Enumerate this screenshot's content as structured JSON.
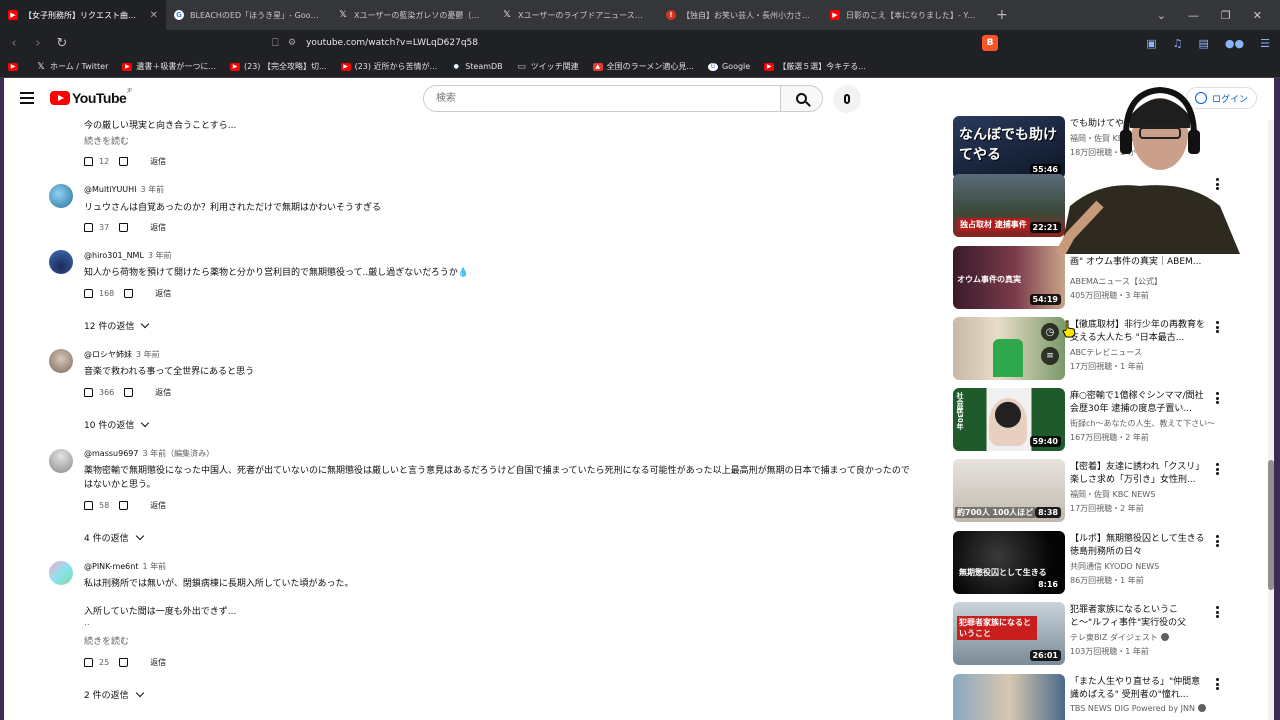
{
  "browser": {
    "tabs": [
      {
        "label": "【女子刑務所】リクエスト曲は「回家」",
        "icon": "youtube-icon",
        "active": true
      },
      {
        "label": "BLEACHのED「ほうき星」- Google 検索",
        "icon": "google-icon",
        "active": false
      },
      {
        "label": "Xユーザーの藍染ガレソの憂鬱（裏垢）",
        "icon": "x-icon",
        "active": false
      },
      {
        "label": "Xユーザーのライブドアニュースさん：「【容疑】",
        "icon": "x-icon",
        "active": false
      },
      {
        "label": "【独自】お笑い芸人・長州小力さんを逮捕",
        "icon": "news-icon",
        "active": false
      },
      {
        "label": "日影のこえ【本になりました】- YouTube",
        "icon": "youtube-icon",
        "active": false
      }
    ],
    "url": "youtube.com/watch?v=LWLqD627q58",
    "bookmarks": [
      {
        "label": "ホーム / Twitter",
        "icon": "x-icon"
      },
      {
        "label": "遺書＋吸書が一つに...",
        "icon": "youtube-icon"
      },
      {
        "label": "(23) 【完全攻略】切...",
        "icon": "youtube-icon"
      },
      {
        "label": "(23) 近所から苦情が...",
        "icon": "youtube-icon"
      },
      {
        "label": "SteamDB",
        "icon": "steam-icon"
      },
      {
        "label": "ツイッチ関連",
        "icon": "folder-icon"
      },
      {
        "label": "全国のラーメン適心見...",
        "icon": "ramen-icon"
      },
      {
        "label": "Google",
        "icon": "google-icon"
      },
      {
        "label": "【厳選５選】今キテる...",
        "icon": "youtube-icon"
      }
    ]
  },
  "header": {
    "logo_word": "YouTube",
    "logo_region": "JP",
    "search_placeholder": "検索",
    "login_label": "ログイン"
  },
  "comments": [
    {
      "id": "c0",
      "body_lines": [
        "今の厳しい現実と向き合うことすら..."
      ],
      "read_more": "続きを読む",
      "likes": "12",
      "reply_label": "返信"
    },
    {
      "id": "c1",
      "author": "@MultiYUUHI",
      "date": "3 年前",
      "body_lines": [
        "リュウさんは自覚あったのか？利用されただけで無期はかわいそうすぎる"
      ],
      "likes": "37",
      "reply_label": "返信"
    },
    {
      "id": "c2",
      "author": "@hiro301_NML",
      "date": "3 年前",
      "body_lines": [
        "知人から荷物を預けて開けたら薬物と分かり営利目的で無期懲役って..厳し過ぎないだろうか💧"
      ],
      "likes": "168",
      "reply_label": "返信",
      "replies_label": "12 件の返信"
    },
    {
      "id": "c3",
      "author": "@ロシヤ姉妹",
      "date": "3 年前",
      "body_lines": [
        "音楽で救われる事って全世界にあると思う"
      ],
      "likes": "366",
      "reply_label": "返信",
      "replies_label": "10 件の返信"
    },
    {
      "id": "c4",
      "author": "@massu9697",
      "date": "3 年前（編集済み）",
      "body_lines": [
        "薬物密輸で無期懲役になった中国人、死者が出ていないのに無期懲役は厳しいと言う意見はあるだろうけど自国で捕まっていたら死刑になる可能性があった以上最高刑が無期の日本で捕まって良かったので",
        "はないかと思う。"
      ],
      "likes": "58",
      "reply_label": "返信",
      "replies_label": "4 件の返信"
    },
    {
      "id": "c5",
      "author": "@PINK-me6nt",
      "date": "1 年前",
      "body_lines": [
        "私は刑務所では無いが、閉鎖病棟に長期入所していた頃があった。",
        "",
        "入所していた間は一度も外出できず...",
        ".."
      ],
      "read_more": "続きを読む",
      "likes": "25",
      "reply_label": "返信",
      "replies_label": "2 件の返信"
    }
  ],
  "related": [
    {
      "title": "でも助けてやる",
      "channel": "福岡・佐賀 KBC NEWS",
      "meta": "18万回視聴・3 か",
      "duration": "55:46",
      "thumb_text": "なんぼでも助けてやる"
    },
    {
      "title": "",
      "channel": "",
      "meta": "",
      "duration": "22:21",
      "thumb_text": "独占取材 逮捕事件"
    },
    {
      "title": "画\" オウム事件の真実｜ABEM...",
      "channel": "ABEMAニュース【公式】",
      "meta": "405万回視聴・3 年前",
      "duration": "54:19",
      "thumb_text": "オウム事件の真実"
    },
    {
      "title": "【徹底取材】非行少年の再教育を支える大人たち \"日本最古...",
      "channel": "ABCテレビニュース",
      "meta": "17万回視聴・1 年前",
      "duration": "",
      "thumb_text": ""
    },
    {
      "title": "麻○密輸で1億稼ぐシンママ/間社会歴30年 逮捕の度息子置い...",
      "channel": "街録ch〜あなたの人生、教えて下さい〜",
      "meta": "167万回視聴・2 年前",
      "duration": "59:40",
      "thumb_text": "社会歴30年"
    },
    {
      "title": "【密着】友達に誘われ「クスリ」楽しさ求め「万引き」女性刑...",
      "channel": "福岡・佐賀 KBC NEWS",
      "meta": "17万回視聴・2 年前",
      "duration": "8:38",
      "thumb_text": "約700人 100人ほど"
    },
    {
      "title": "【ルポ】無期懲役囚として生きる 徳島刑務所の日々",
      "channel": "共同通信 KYODO NEWS",
      "meta": "86万回視聴・1 年前",
      "duration": "8:16",
      "thumb_text": "無期懲役囚として生きる"
    },
    {
      "title": "犯罪者家族になるということ〜\"ルフィ事件\"実行役の父【ザ...",
      "channel": "テレ東BIZ ダイジェスト",
      "meta": "103万回視聴・1 年前",
      "duration": "26:01",
      "thumb_text": "犯罪者家族になるということ",
      "verified": true
    },
    {
      "title": "「また人生やり直せる」\"仲間意識めばえる\" 受刑者の\"憧れ...",
      "channel": "TBS NEWS DIG Powered by JNN",
      "meta": "",
      "duration": "",
      "thumb_text": "",
      "verified": true
    }
  ],
  "colors": {
    "brand_red": "#ff0000",
    "link_blue": "#065fd4",
    "frame_purple": "#3d2a55"
  }
}
